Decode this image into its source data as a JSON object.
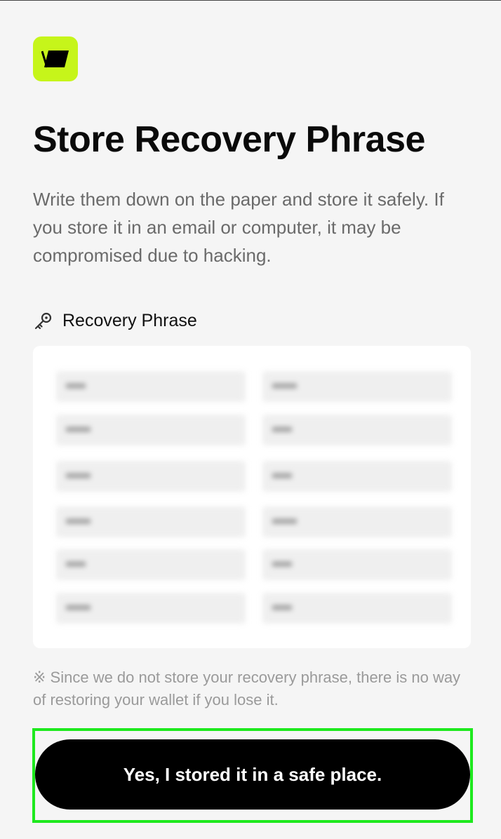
{
  "app": {
    "brand_color": "#c6f51a"
  },
  "header": {
    "title": "Store Recovery Phrase",
    "description": "Write them down on the paper and store it safely. If you store it in an email or computer, it may be compromised due to hacking."
  },
  "phrase_section": {
    "label": "Recovery Phrase",
    "icon": "key-icon",
    "words": [
      "••••",
      "•••••",
      "•••••",
      "••••",
      "•••••",
      "••••",
      "•••••",
      "•••••",
      "••••",
      "••••",
      "•••••",
      "••••"
    ],
    "blurred": true
  },
  "warning": "※ Since we do not store your recovery phrase, there is no way of restoring your wallet if you lose it.",
  "confirm_button": {
    "label": "Yes, I stored it in a safe place."
  }
}
